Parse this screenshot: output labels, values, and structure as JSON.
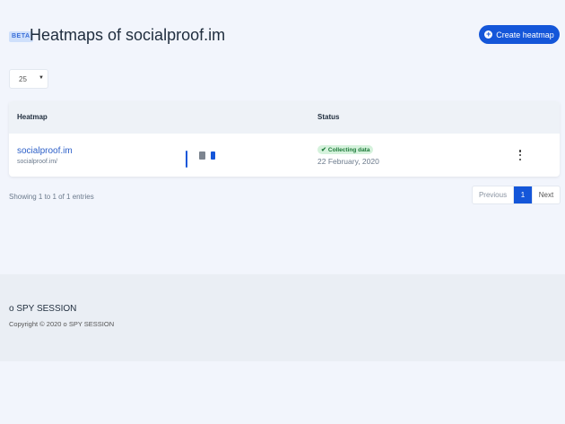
{
  "header": {
    "beta_label": "BETA",
    "title": "Heatmaps of socialproof.im",
    "create_button": "Create heatmap"
  },
  "per_page": {
    "value": "25"
  },
  "table": {
    "columns": [
      "Heatmap",
      "Status"
    ],
    "rows": [
      {
        "name": "socialproof.im",
        "url": "socialproof.im/",
        "devices": [
          "desktop",
          "tablet",
          "mobile"
        ],
        "status": "Collecting data",
        "date": "22 February, 2020"
      }
    ]
  },
  "entries_info": "Showing 1 to 1 of 1 entries",
  "pagination": {
    "prev": "Previous",
    "current": "1",
    "next": "Next"
  },
  "footer": {
    "brand": "o SPY SESSION",
    "copyright": "Copyright © 2020 o SPY SESSION"
  },
  "colors": {
    "accent": "#1456d9",
    "status_green": "#d5f2dc"
  },
  "icons": [
    "plus-circle-icon",
    "caret-down-icon",
    "desktop-icon",
    "tablet-icon",
    "mobile-icon",
    "check-icon",
    "kebab-menu-icon"
  ]
}
